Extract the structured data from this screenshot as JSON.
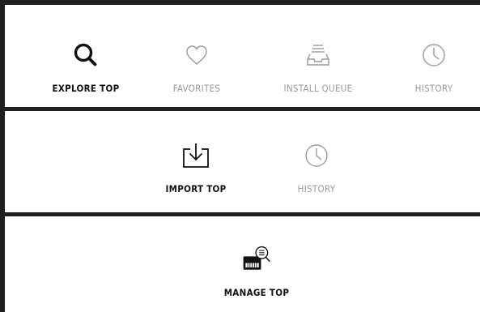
{
  "section_explore": {
    "tabs": [
      {
        "label": "EXPLORE TOP",
        "icon": "search-icon",
        "active": true
      },
      {
        "label": "FAVORITES",
        "icon": "heart-icon",
        "active": false
      },
      {
        "label": "INSTALL QUEUE",
        "icon": "inbox-tray-icon",
        "active": false
      },
      {
        "label": "HISTORY",
        "icon": "clock-icon",
        "active": false
      }
    ]
  },
  "section_import": {
    "tabs": [
      {
        "label": "IMPORT TOP",
        "icon": "import-icon",
        "active": true
      },
      {
        "label": "HISTORY",
        "icon": "clock-icon",
        "active": false
      }
    ]
  },
  "section_manage": {
    "tabs": [
      {
        "label": "MANAGE TOP",
        "icon": "keyboard-search-icon",
        "active": true
      }
    ]
  },
  "colors": {
    "active": "#111111",
    "inactive": "#9a9a9a",
    "divider": "#1f1f1f"
  }
}
